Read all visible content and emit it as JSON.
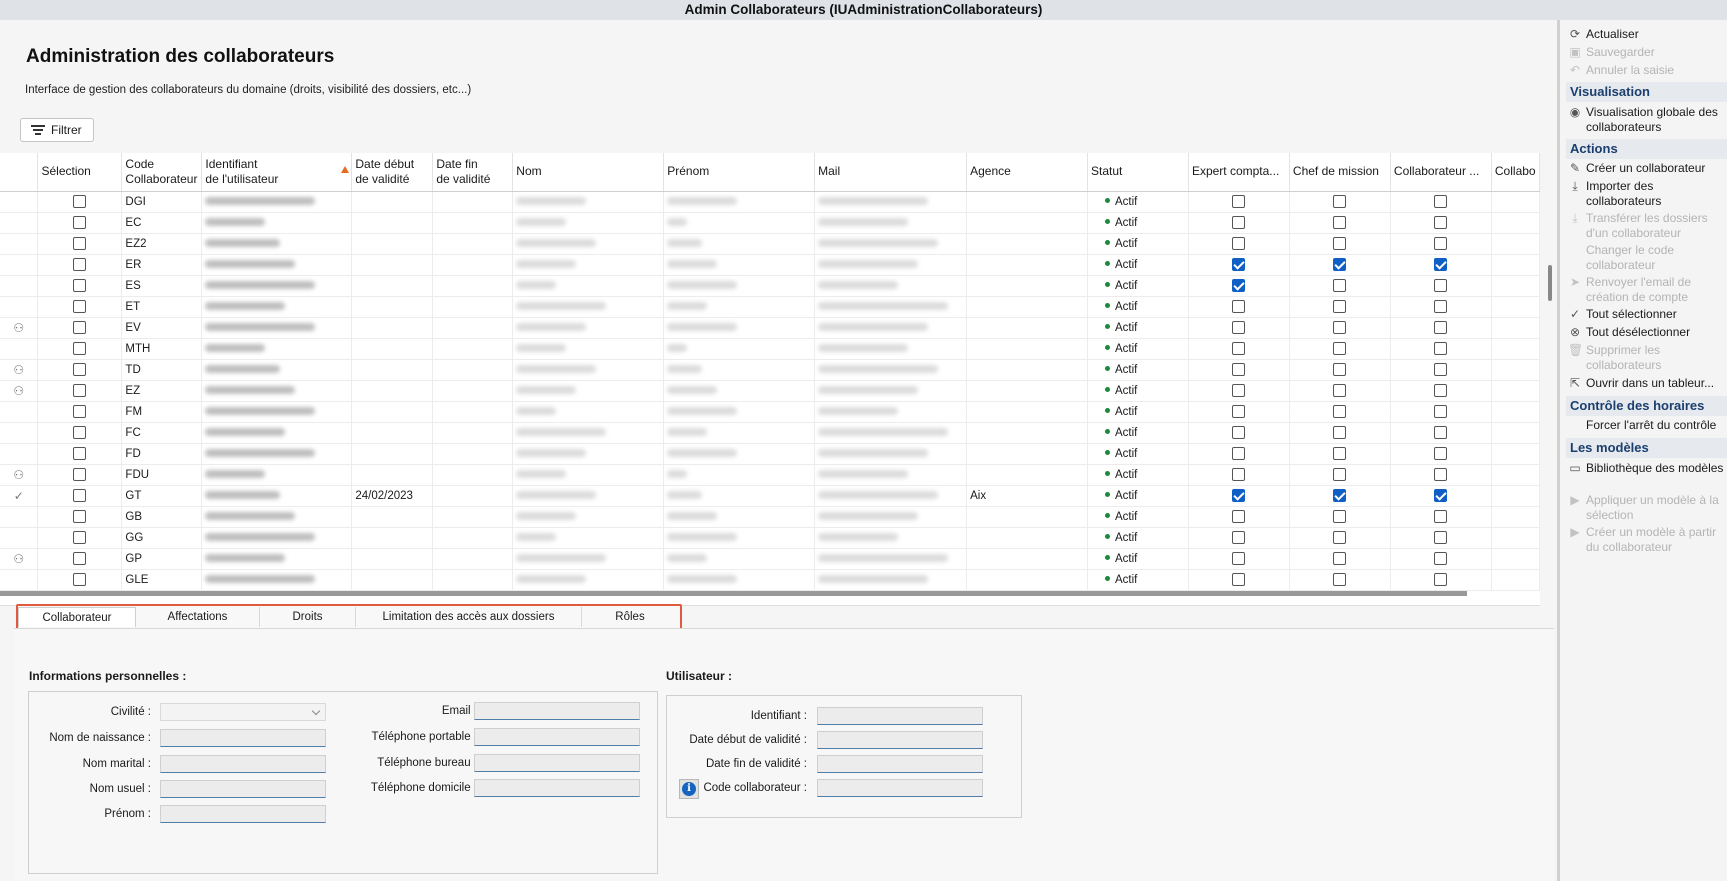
{
  "window": {
    "title": "Admin Collaborateurs (IUAdministrationCollaborateurs)"
  },
  "page": {
    "title": "Administration des collaborateurs",
    "subtitle": "Interface de gestion des collaborateurs du domaine (droits, visibilité des dossiers, etc...)",
    "filter_label": "Filtrer"
  },
  "grid": {
    "headers": {
      "selection": "Sélection",
      "code_l1": "Code",
      "code_l2": "Collaborateur",
      "ident_l1": "Identifiant",
      "ident_l2": "de l'utilisateur",
      "debut_l1": "Date début",
      "debut_l2": "de validité",
      "fin_l1": "Date fin",
      "fin_l2": "de validité",
      "nom": "Nom",
      "prenom": "Prénom",
      "mail": "Mail",
      "agence": "Agence",
      "statut": "Statut",
      "expert": "Expert compta...",
      "chef": "Chef de mission",
      "collab": "Collaborateur ...",
      "collabo": "Collabo"
    },
    "rows": [
      {
        "icon": "",
        "code": "DGI",
        "debut": "",
        "agence": "",
        "statut": "Actif",
        "expert": false,
        "chef": false,
        "collab": false
      },
      {
        "icon": "",
        "code": "EC",
        "debut": "",
        "agence": "",
        "statut": "Actif",
        "expert": false,
        "chef": false,
        "collab": false
      },
      {
        "icon": "",
        "code": "EZ2",
        "debut": "",
        "agence": "",
        "statut": "Actif",
        "expert": false,
        "chef": false,
        "collab": false
      },
      {
        "icon": "",
        "code": "ER",
        "debut": "",
        "agence": "",
        "statut": "Actif",
        "expert": true,
        "chef": true,
        "collab": true
      },
      {
        "icon": "",
        "code": "ES",
        "debut": "",
        "agence": "",
        "statut": "Actif",
        "expert": true,
        "chef": false,
        "collab": false
      },
      {
        "icon": "",
        "code": "ET",
        "debut": "",
        "agence": "",
        "statut": "Actif",
        "expert": false,
        "chef": false,
        "collab": false
      },
      {
        "icon": "user-gear-icon",
        "code": "EV",
        "debut": "",
        "agence": "",
        "statut": "Actif",
        "expert": false,
        "chef": false,
        "collab": false
      },
      {
        "icon": "",
        "code": "MTH",
        "debut": "",
        "agence": "",
        "statut": "Actif",
        "expert": false,
        "chef": false,
        "collab": false
      },
      {
        "icon": "user-gear-icon",
        "code": "TD",
        "debut": "",
        "agence": "",
        "statut": "Actif",
        "expert": false,
        "chef": false,
        "collab": false
      },
      {
        "icon": "user-gear-icon",
        "code": "EZ",
        "debut": "",
        "agence": "",
        "statut": "Actif",
        "expert": false,
        "chef": false,
        "collab": false
      },
      {
        "icon": "",
        "code": "FM",
        "debut": "",
        "agence": "",
        "statut": "Actif",
        "expert": false,
        "chef": false,
        "collab": false
      },
      {
        "icon": "",
        "code": "FC",
        "debut": "",
        "agence": "",
        "statut": "Actif",
        "expert": false,
        "chef": false,
        "collab": false
      },
      {
        "icon": "",
        "code": "FD",
        "debut": "",
        "agence": "",
        "statut": "Actif",
        "expert": false,
        "chef": false,
        "collab": false
      },
      {
        "icon": "user-gear-icon",
        "code": "FDU",
        "debut": "",
        "agence": "",
        "statut": "Actif",
        "expert": false,
        "chef": false,
        "collab": false
      },
      {
        "icon": "check-circle-icon",
        "code": "GT",
        "debut": "24/02/2023",
        "agence": "Aix",
        "statut": "Actif",
        "expert": true,
        "chef": true,
        "collab": true
      },
      {
        "icon": "",
        "code": "GB",
        "debut": "",
        "agence": "",
        "statut": "Actif",
        "expert": false,
        "chef": false,
        "collab": false
      },
      {
        "icon": "",
        "code": "GG",
        "debut": "",
        "agence": "",
        "statut": "Actif",
        "expert": false,
        "chef": false,
        "collab": false
      },
      {
        "icon": "user-gear-icon",
        "code": "GP",
        "debut": "",
        "agence": "",
        "statut": "Actif",
        "expert": false,
        "chef": false,
        "collab": false
      },
      {
        "icon": "",
        "code": "GLE",
        "debut": "",
        "agence": "",
        "statut": "Actif",
        "expert": false,
        "chef": false,
        "collab": false
      }
    ]
  },
  "tabs": [
    "Collaborateur",
    "Affectations",
    "Droits",
    "Limitation des accès aux dossiers",
    "Rôles"
  ],
  "personal": {
    "title": "Informations personnelles :",
    "civilite": "Civilité :",
    "nom_naissance": "Nom de naissance :",
    "nom_marital": "Nom marital :",
    "nom_usuel": "Nom usuel :",
    "prenom": "Prénom :",
    "email": "Email :",
    "tel_portable": "Téléphone portable :",
    "tel_bureau": "Téléphone bureau :",
    "tel_domicile": "Téléphone domicile :"
  },
  "user": {
    "title": "Utilisateur :",
    "identifiant": "Identifiant :",
    "date_debut": "Date début de validité :",
    "date_fin": "Date fin de validité :",
    "code": "Code collaborateur :"
  },
  "sidebar": {
    "actualiser": "Actualiser",
    "sauvegarder": "Sauvegarder",
    "annuler": "Annuler la saisie",
    "sec_visualisation": "Visualisation",
    "visu_globale": "Visualisation globale des collaborateurs",
    "sec_actions": "Actions",
    "creer": "Créer un collaborateur",
    "importer": "Importer des collaborateurs",
    "transferer": "Transférer les dossiers d'un collaborateur",
    "changer_code": "Changer le code collaborateur",
    "renvoyer": "Renvoyer l'email de création de compte",
    "tout_sel": "Tout sélectionner",
    "tout_desel": "Tout désélectionner",
    "supprimer": "Supprimer les collaborateurs",
    "ouvrir": "Ouvrir dans un tableur...",
    "sec_controle": "Contrôle des horaires",
    "forcer": "Forcer l'arrêt du contrôle",
    "sec_modeles": "Les modèles",
    "bibliotheque": "Bibliothèque des modèles",
    "appliquer": "Appliquer un modèle à la sélection",
    "creer_modele": "Créer un modèle à partir du collaborateur"
  }
}
